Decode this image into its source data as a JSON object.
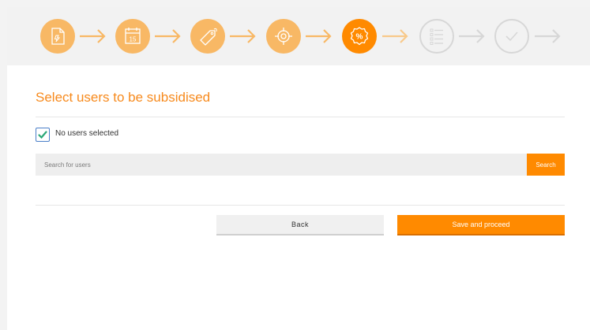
{
  "wizard": {
    "steps": [
      {
        "icon": "document-icon",
        "state": "completed"
      },
      {
        "icon": "calendar-icon",
        "state": "completed",
        "icon_text": "15"
      },
      {
        "icon": "price-tag-icon",
        "state": "completed"
      },
      {
        "icon": "target-icon",
        "state": "completed"
      },
      {
        "icon": "percent-badge-icon",
        "state": "current",
        "icon_text": "%"
      },
      {
        "icon": "list-icon",
        "state": "upcoming"
      },
      {
        "icon": "checkmark-icon",
        "state": "upcoming"
      }
    ]
  },
  "page": {
    "title": "Select users to be subsidised"
  },
  "selection": {
    "checked": true,
    "label": "No users selected"
  },
  "search": {
    "placeholder": "Search for users",
    "value": "",
    "button_label": "Search"
  },
  "actions": {
    "back_label": "Back",
    "save_label": "Save and proceed"
  },
  "colors": {
    "accent": "#ff8a00",
    "step_completed": "#f8b865",
    "step_upcoming": "#d7d7d7",
    "title": "#f78a1d",
    "checkbox_check": "#2aa876"
  }
}
